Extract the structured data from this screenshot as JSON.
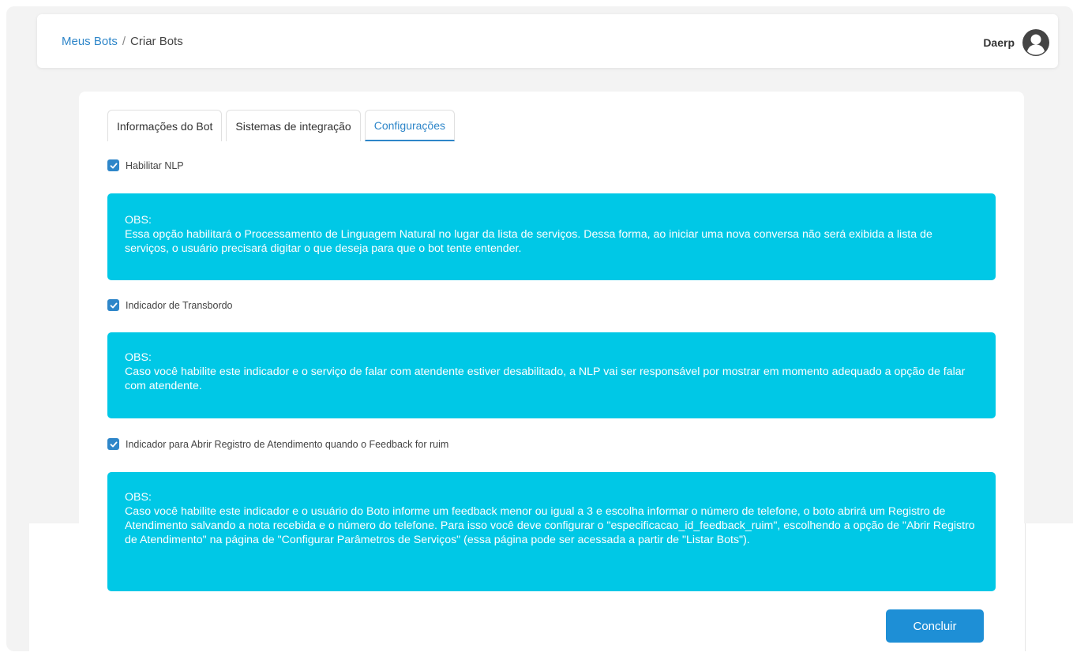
{
  "breadcrumb": {
    "link": "Meus Bots",
    "separator": "/",
    "current": "Criar Bots"
  },
  "user": {
    "name": "Daerp",
    "avatar_icon": "user-avatar-icon"
  },
  "tabs": [
    {
      "label": "Informações do Bot",
      "active": false
    },
    {
      "label": "Sistemas de integração",
      "active": false
    },
    {
      "label": "Configurações",
      "active": true
    }
  ],
  "options": [
    {
      "label": "Habilitar NLP",
      "checked": true,
      "obs_title": "OBS:",
      "obs_text": "Essa opção habilitará o Processamento de Linguagem Natural no lugar da lista de serviços. Dessa forma, ao iniciar uma nova conversa não será exibida a lista de serviços, o usuário precisará digitar o que deseja para que o bot tente entender."
    },
    {
      "label": "Indicador de Transbordo",
      "checked": true,
      "obs_title": "OBS:",
      "obs_text": "Caso você habilite este indicador e o serviço de falar com atendente estiver desabilitado, a NLP vai ser responsável por mostrar em momento adequado a opção de falar com atendente."
    },
    {
      "label": "Indicador para Abrir Registro de Atendimento quando o Feedback for ruim",
      "checked": true,
      "obs_title": "OBS:",
      "obs_text": "Caso você habilite este indicador e o usuário do Boto informe um feedback menor ou igual a 3 e escolha informar o número de telefone, o boto abrirá um Registro de Atendimento salvando a nota recebida e o número do telefone. Para isso você deve configurar o \"especificacao_id_feedback_ruim\", escolhendo a opção de \"Abrir Registro de Atendimento\" na página de \"Configurar Parâmetros de Serviços\" (essa página pode ser acessada a partir de \"Listar Bots\")."
    }
  ],
  "submit_label": "Concluir",
  "colors": {
    "accent": "#2e86c9",
    "obs_background": "#00c8e6",
    "button": "#1e8fd6"
  }
}
